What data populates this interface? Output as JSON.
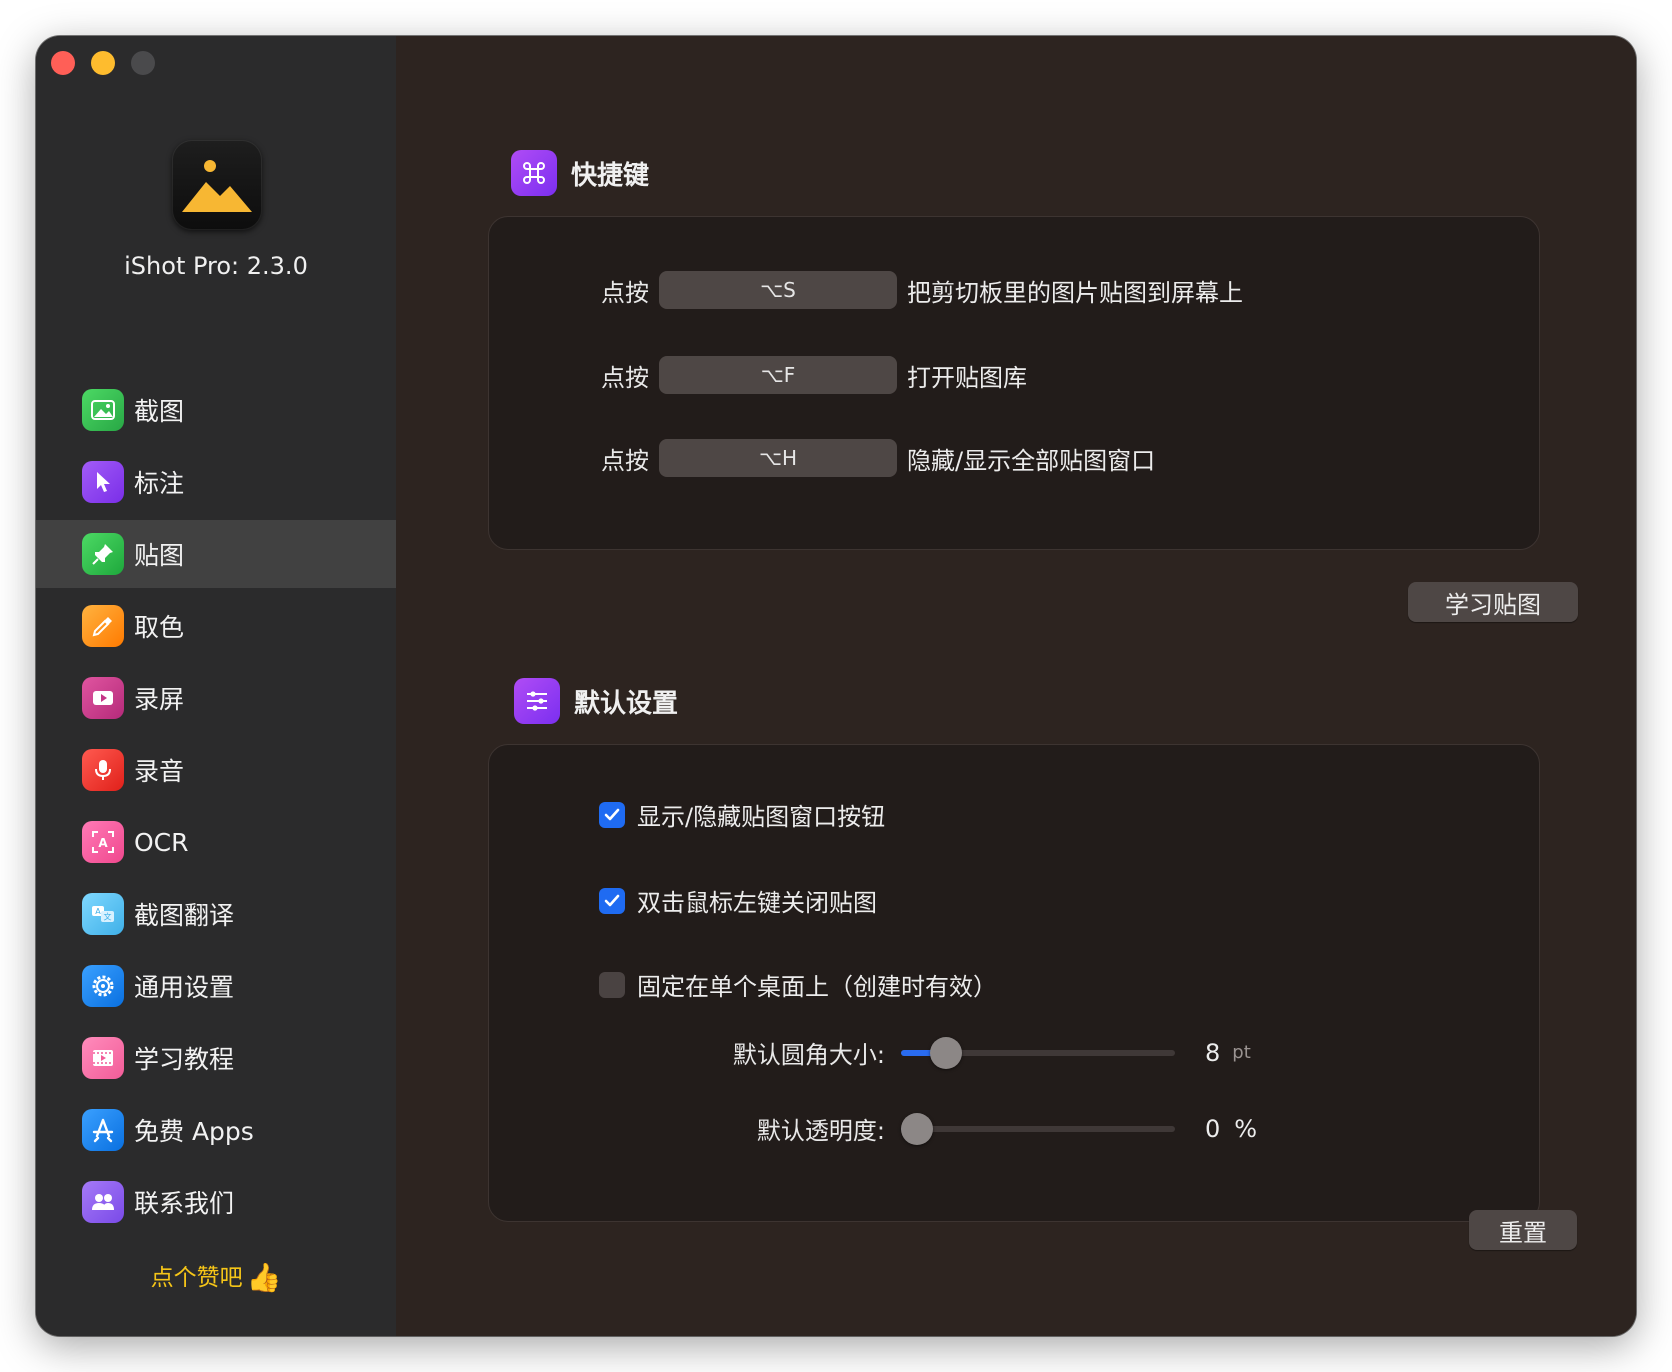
{
  "sidebar": {
    "app_version": "iShot Pro: 2.3.0",
    "items": [
      {
        "label": "截图",
        "icon": "image-icon",
        "color": "#34c759"
      },
      {
        "label": "标注",
        "icon": "cursor-icon",
        "color": "#8e44f0"
      },
      {
        "label": "贴图",
        "icon": "pin-icon",
        "color": "#30c94a",
        "active": true
      },
      {
        "label": "取色",
        "icon": "eyedropper-icon",
        "color": "#ff9500"
      },
      {
        "label": "录屏",
        "icon": "video-camera-icon",
        "color": "#d63b8e"
      },
      {
        "label": "录音",
        "icon": "microphone-icon",
        "color": "#ff3b30"
      },
      {
        "label": "OCR",
        "icon": "ocr-icon",
        "color": "#ff5fa2"
      },
      {
        "label": "截图翻译",
        "icon": "translate-icon",
        "color": "#5ac8fa"
      },
      {
        "label": "通用设置",
        "icon": "gear-icon",
        "color": "#1a8cff"
      },
      {
        "label": "学习教程",
        "icon": "film-icon",
        "color": "#ff6fa8"
      },
      {
        "label": "免费 Apps",
        "icon": "app-store-icon",
        "color": "#1a8cff"
      },
      {
        "label": "联系我们",
        "icon": "contacts-icon",
        "color": "#8e5cf0"
      }
    ],
    "like_text": "点个赞吧",
    "like_emoji": "👍"
  },
  "shortcuts": {
    "title": "快捷键",
    "rows": [
      {
        "prefix": "点按",
        "key": "⌥S",
        "desc": "把剪切板里的图片贴图到屏幕上"
      },
      {
        "prefix": "点按",
        "key": "⌥F",
        "desc": "打开贴图库"
      },
      {
        "prefix": "点按",
        "key": "⌥H",
        "desc": "隐藏/显示全部贴图窗口"
      }
    ],
    "learn_button": "学习贴图"
  },
  "defaults": {
    "title": "默认设置",
    "checkboxes": [
      {
        "label": "显示/隐藏贴图窗口按钮",
        "checked": true
      },
      {
        "label": "双击鼠标左键关闭贴图",
        "checked": true
      },
      {
        "label": "固定在单个桌面上（创建时有效）",
        "checked": false
      }
    ],
    "sliders": [
      {
        "label": "默认圆角大小:",
        "value": "8",
        "unit": "pt",
        "fraction": 0.12
      },
      {
        "label": "默认透明度:",
        "value": "0",
        "unit": "%",
        "fraction": 0.0
      }
    ],
    "reset_button": "重置"
  }
}
